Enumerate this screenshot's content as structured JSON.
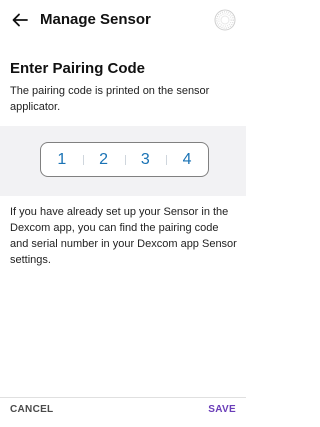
{
  "header": {
    "title": "Manage Sensor",
    "back_icon": "arrow-left-icon",
    "sensor_icon": "sensor-icon"
  },
  "pairing": {
    "heading": "Enter Pairing Code",
    "description": "The pairing code is printed on the sensor applicator.",
    "code_digits": [
      "1",
      "2",
      "3",
      "4"
    ]
  },
  "info": {
    "text": "If you have already set up your Sensor in the Dexcom app, you can find the pairing code and serial number in your Dexcom app Sensor settings."
  },
  "footer": {
    "cancel_label": "CANCEL",
    "save_label": "SAVE"
  },
  "colors": {
    "accent": "#6a3db8",
    "digit": "#1a73b5",
    "band": "#f2f2f4"
  }
}
